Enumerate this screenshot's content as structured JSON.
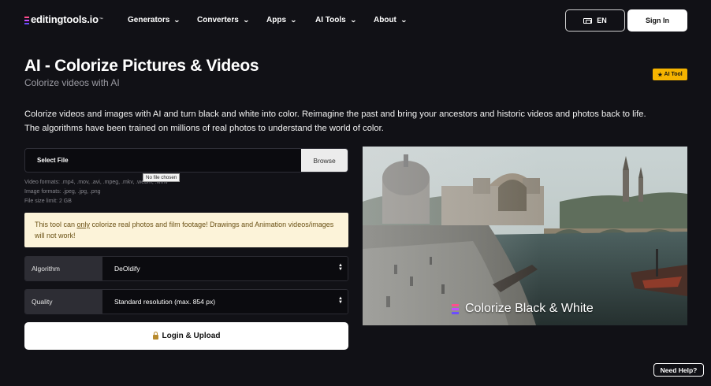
{
  "nav": {
    "logo": "editingtools.io",
    "logo_sup": "™",
    "menu": [
      {
        "label": "Generators"
      },
      {
        "label": "Converters"
      },
      {
        "label": "Apps"
      },
      {
        "label": "AI Tools"
      },
      {
        "label": "About"
      }
    ],
    "language": "EN",
    "signin": "Sign In"
  },
  "header": {
    "title": "AI - Colorize Pictures & Videos",
    "subtitle": "Colorize videos with AI",
    "badge": "AI Tool"
  },
  "description": {
    "line1": "Colorize videos and images with AI and turn black and white into color. Reimagine the past and bring your ancestors and historic videos and photos back to life.",
    "line2": "The algorithms have been trained on millions of real photos to understand the world of color."
  },
  "file": {
    "label": "Select File",
    "browse": "Browse",
    "tooltip": "No file chosen",
    "video_formats": "Video formats: .mp4, .mov, .avi, .mpeg, .mkv, .webm, .wmv",
    "image_formats": "Image formats: .jpeg, .jpg, .png",
    "size_limit": "File size limit: 2 GB"
  },
  "notice": {
    "before": "This tool can ",
    "emphasis": "only",
    "after": " colorize real photos and film footage! Drawings and Animation videos/images will not work!"
  },
  "algorithm": {
    "label": "Algorithm",
    "value": "DeOldify"
  },
  "quality": {
    "label": "Quality",
    "value": "Standard resolution (max. 854 px)"
  },
  "upload_button": "Login & Upload",
  "preview": {
    "caption": "Colorize Black & White"
  },
  "help_button": "Need Help?",
  "colors": {
    "background": "#111116",
    "badge": "#f5b400",
    "notice_bg": "#fcf3d9",
    "notice_text": "#6b5216",
    "logo_accent": "#c34dff"
  }
}
